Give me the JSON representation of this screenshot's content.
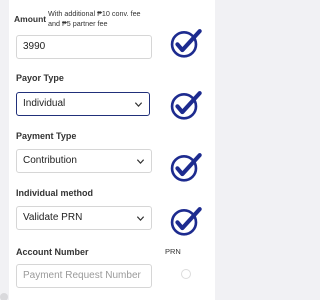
{
  "amount": {
    "label": "Amount",
    "fee_line1": "With additional ₱10 conv. fee",
    "fee_line2": "and ₱5 partner fee",
    "value": "3990"
  },
  "payor_type": {
    "label": "Payor Type",
    "selected": "Individual"
  },
  "payment_type": {
    "label": "Payment Type",
    "selected": "Contribution"
  },
  "individual_method": {
    "label": "Individual method",
    "selected": "Validate PRN"
  },
  "account_number": {
    "label": "Account Number",
    "hint": "PRN",
    "placeholder": "Payment Request Number"
  },
  "colors": {
    "accent": "#21307a",
    "checkmark": "#1d2b8f"
  },
  "icons": [
    "checkmark-icon",
    "chevron-down-icon"
  ]
}
